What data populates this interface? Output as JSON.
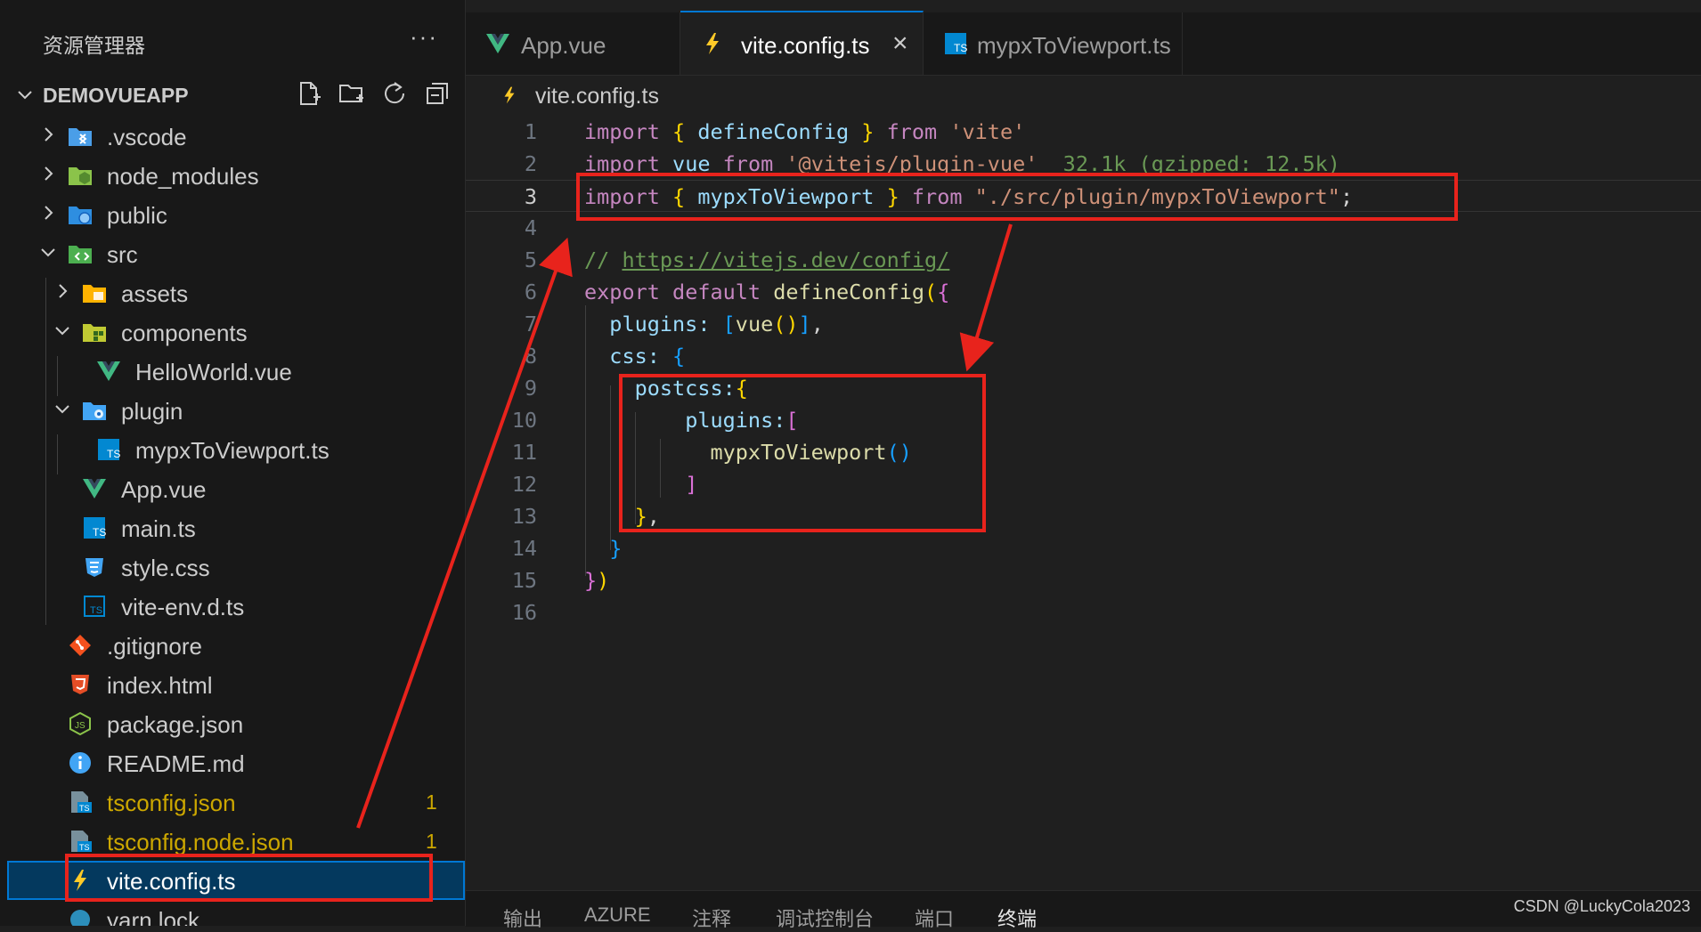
{
  "sidebar": {
    "title": "资源管理器",
    "more": "···",
    "project": "DEMOVUEAPP",
    "toolbar_icons": [
      "new-file-icon",
      "new-folder-icon",
      "refresh-icon",
      "collapse-all-icon"
    ],
    "items": [
      {
        "label": ".vscode",
        "icon": "vscode-folder-icon"
      },
      {
        "label": "node_modules",
        "icon": "node-folder-icon"
      },
      {
        "label": "public",
        "icon": "public-folder-icon"
      },
      {
        "label": "src",
        "icon": "src-folder-icon"
      },
      {
        "label": "assets",
        "icon": "assets-folder-icon"
      },
      {
        "label": "components",
        "icon": "components-folder-icon"
      },
      {
        "label": "HelloWorld.vue",
        "icon": "vue-file-icon"
      },
      {
        "label": "plugin",
        "icon": "plugin-folder-icon"
      },
      {
        "label": "mypxToViewport.ts",
        "icon": "ts-file-icon"
      },
      {
        "label": "App.vue",
        "icon": "vue-file-icon"
      },
      {
        "label": "main.ts",
        "icon": "ts-file-icon"
      },
      {
        "label": "style.css",
        "icon": "css-file-icon"
      },
      {
        "label": "vite-env.d.ts",
        "icon": "ts-def-file-icon"
      },
      {
        "label": ".gitignore",
        "icon": "git-icon"
      },
      {
        "label": "index.html",
        "icon": "html-file-icon"
      },
      {
        "label": "package.json",
        "icon": "json-file-icon"
      },
      {
        "label": "README.md",
        "icon": "info-icon"
      },
      {
        "label": "tsconfig.json",
        "icon": "tsconfig-icon",
        "badge": "1"
      },
      {
        "label": "tsconfig.node.json",
        "icon": "tsconfig-icon",
        "badge": "1"
      },
      {
        "label": "vite.config.ts",
        "icon": "vite-icon"
      },
      {
        "label": "yarn.lock",
        "icon": "yarn-icon"
      }
    ]
  },
  "tabs": [
    {
      "label": "App.vue",
      "icon": "vue-file-icon"
    },
    {
      "label": "vite.config.ts",
      "icon": "vite-icon",
      "close": "×"
    },
    {
      "label": "mypxToViewport.ts",
      "icon": "ts-file-icon"
    }
  ],
  "breadcrumb": "vite.config.ts",
  "editor": {
    "line_numbers": [
      "1",
      "2",
      "3",
      "4",
      "5",
      "6",
      "7",
      "8",
      "9",
      "10",
      "11",
      "12",
      "13",
      "14",
      "15",
      "16"
    ],
    "line1": {
      "import": "import",
      "b_open": "{",
      "name": "defineConfig",
      "b_close": "}",
      "from": "from",
      "str": "'vite'"
    },
    "line2": {
      "import": "import",
      "name": "vue",
      "from": "from",
      "str": "'@vitejs/plugin-vue'",
      "hint": "32.1k (gzipped: 12.5k)"
    },
    "line3": {
      "import": "import",
      "b_open": "{",
      "name": "mypxToViewport",
      "b_close": "}",
      "from": "from",
      "str": "\"./src/plugin/mypxToViewport\"",
      "semi": ";"
    },
    "line5": {
      "cmt": "//",
      "url": "https://vitejs.dev/config/"
    },
    "line6": {
      "export": "export",
      "default": "default",
      "fn": "defineConfig",
      "p": "(",
      "b": "{"
    },
    "line7": {
      "key": "plugins:",
      "b_open": "[",
      "fn": "vue",
      "p": "()",
      "b_close": "]",
      "comma": ","
    },
    "line8": {
      "key": "css:",
      "b": "{"
    },
    "line9": {
      "key": "postcss:",
      "b": "{"
    },
    "line10": {
      "key": "plugins:",
      "b": "["
    },
    "line11": {
      "fn": "mypxToViewport",
      "p": "()"
    },
    "line12": {
      "b": "]"
    },
    "line13": {
      "b": "}",
      "comma": ","
    },
    "line14": {
      "b": "}"
    },
    "line15": {
      "b": "}",
      "p": ")"
    }
  },
  "panel_tabs": [
    "输出",
    "AZURE",
    "注释",
    "调试控制台",
    "端口",
    "终端"
  ],
  "watermark": "CSDN @LuckyCola2023",
  "colors": {
    "annotation": "#e8231c",
    "accent": "#0078d4",
    "selection": "#04395e"
  }
}
